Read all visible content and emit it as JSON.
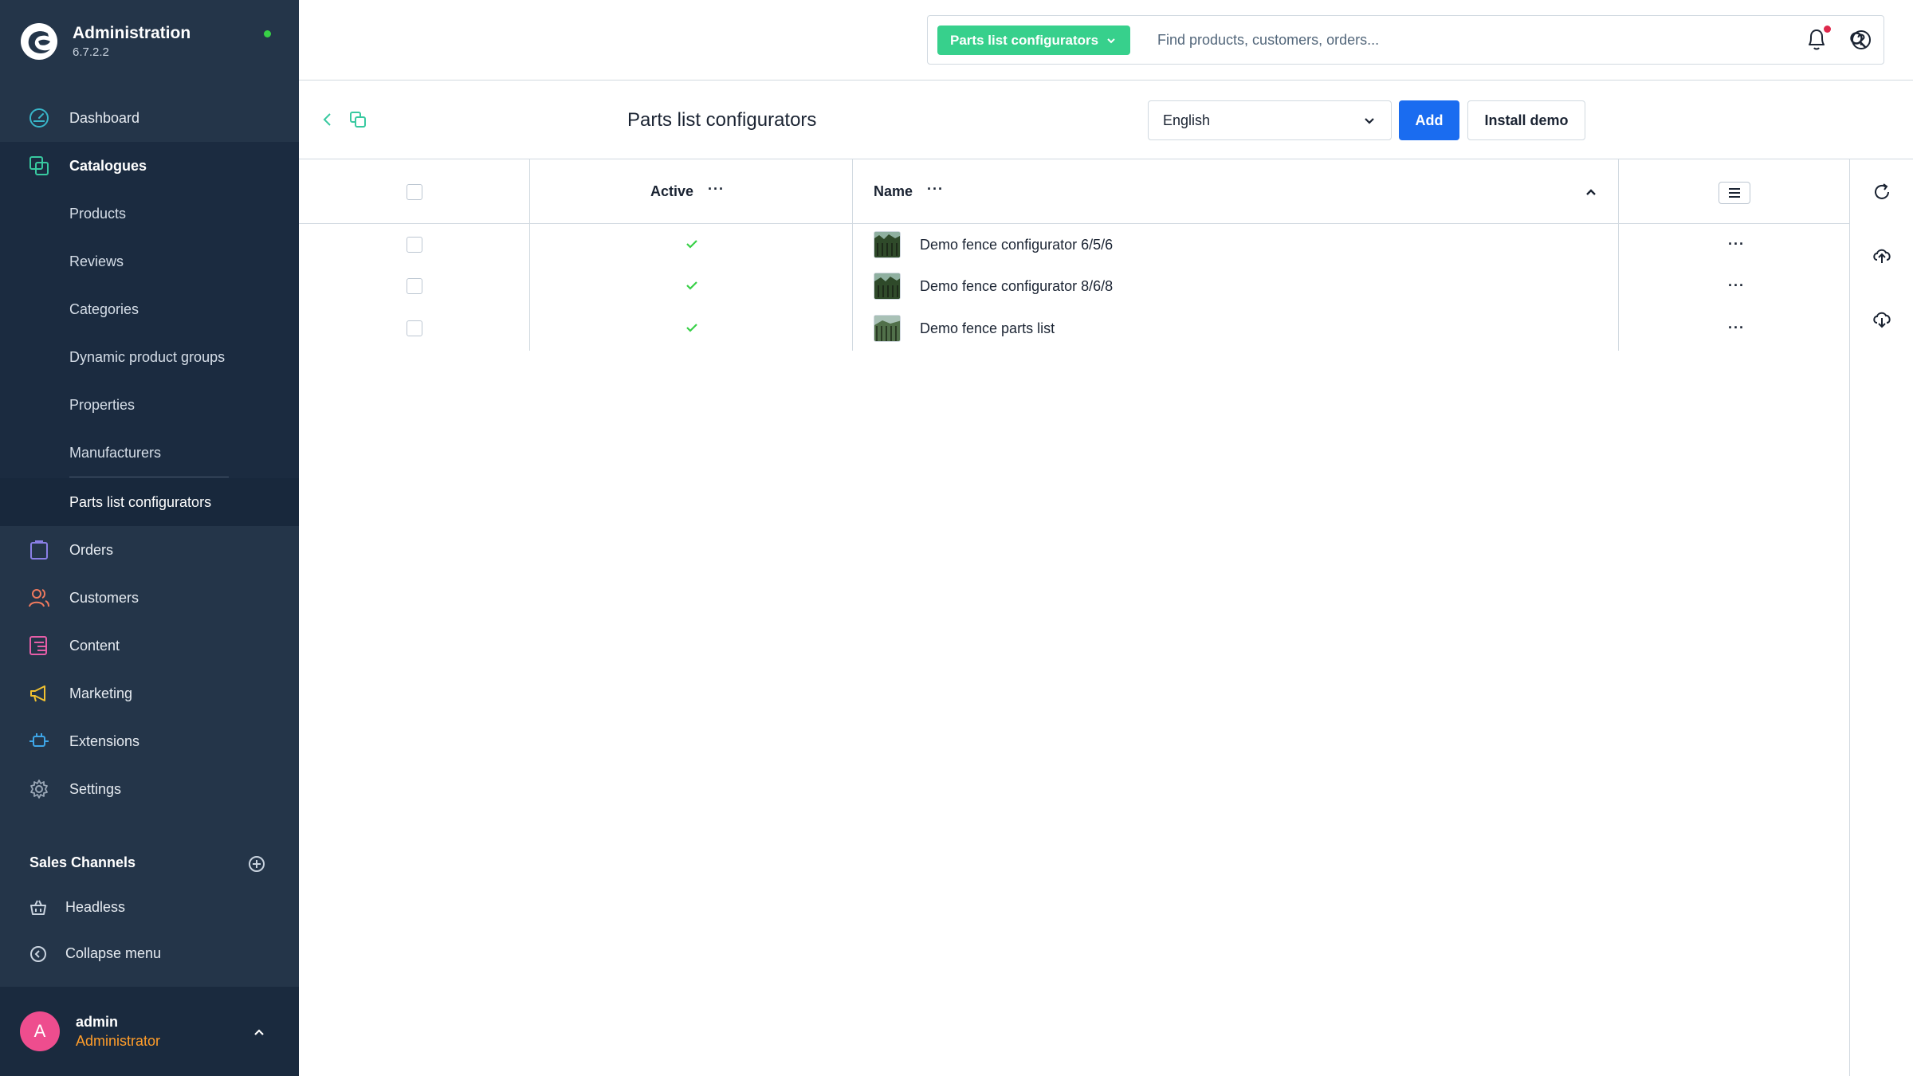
{
  "app": {
    "title": "Administration",
    "version": "6.7.2.2"
  },
  "nav": {
    "dashboard": "Dashboard",
    "catalogues": "Catalogues",
    "catalogue_items": [
      "Products",
      "Reviews",
      "Categories",
      "Dynamic product groups",
      "Properties",
      "Manufacturers",
      "Parts list configurators"
    ],
    "orders": "Orders",
    "customers": "Customers",
    "content": "Content",
    "marketing": "Marketing",
    "extensions": "Extensions",
    "settings": "Settings"
  },
  "sales_channels": {
    "title": "Sales Channels",
    "items": [
      "Headless"
    ],
    "collapse": "Collapse menu"
  },
  "user": {
    "initial": "A",
    "name": "admin",
    "role": "Administrator"
  },
  "search": {
    "module": "Parts list configurators",
    "placeholder": "Find products, customers, orders..."
  },
  "page": {
    "title": "Parts list configurators",
    "language": "English",
    "add_label": "Add",
    "demo_label": "Install demo"
  },
  "grid": {
    "columns": [
      "Active",
      "Name"
    ],
    "rows": [
      {
        "active": true,
        "name": "Demo fence configurator 6/5/6"
      },
      {
        "active": true,
        "name": "Demo fence configurator 8/6/8"
      },
      {
        "active": true,
        "name": "Demo fence parts list"
      }
    ]
  },
  "colors": {
    "sidebar": "#243549",
    "accent": "#1a6cf0",
    "module_chip": "#37d08c",
    "active_check": "#37d046",
    "role": "#ff9d2a",
    "avatar": "#ee4d8e"
  },
  "icons": [
    "shopware-logo",
    "dashboard-icon",
    "catalogue-icon",
    "orders-icon",
    "customers-icon",
    "content-icon",
    "marketing-icon",
    "extensions-icon",
    "settings-icon",
    "plus-circle-icon",
    "basket-icon",
    "collapse-icon",
    "search-icon",
    "bell-icon",
    "help-icon",
    "back-icon",
    "copy-icon",
    "refresh-icon",
    "upload-icon",
    "download-icon"
  ]
}
